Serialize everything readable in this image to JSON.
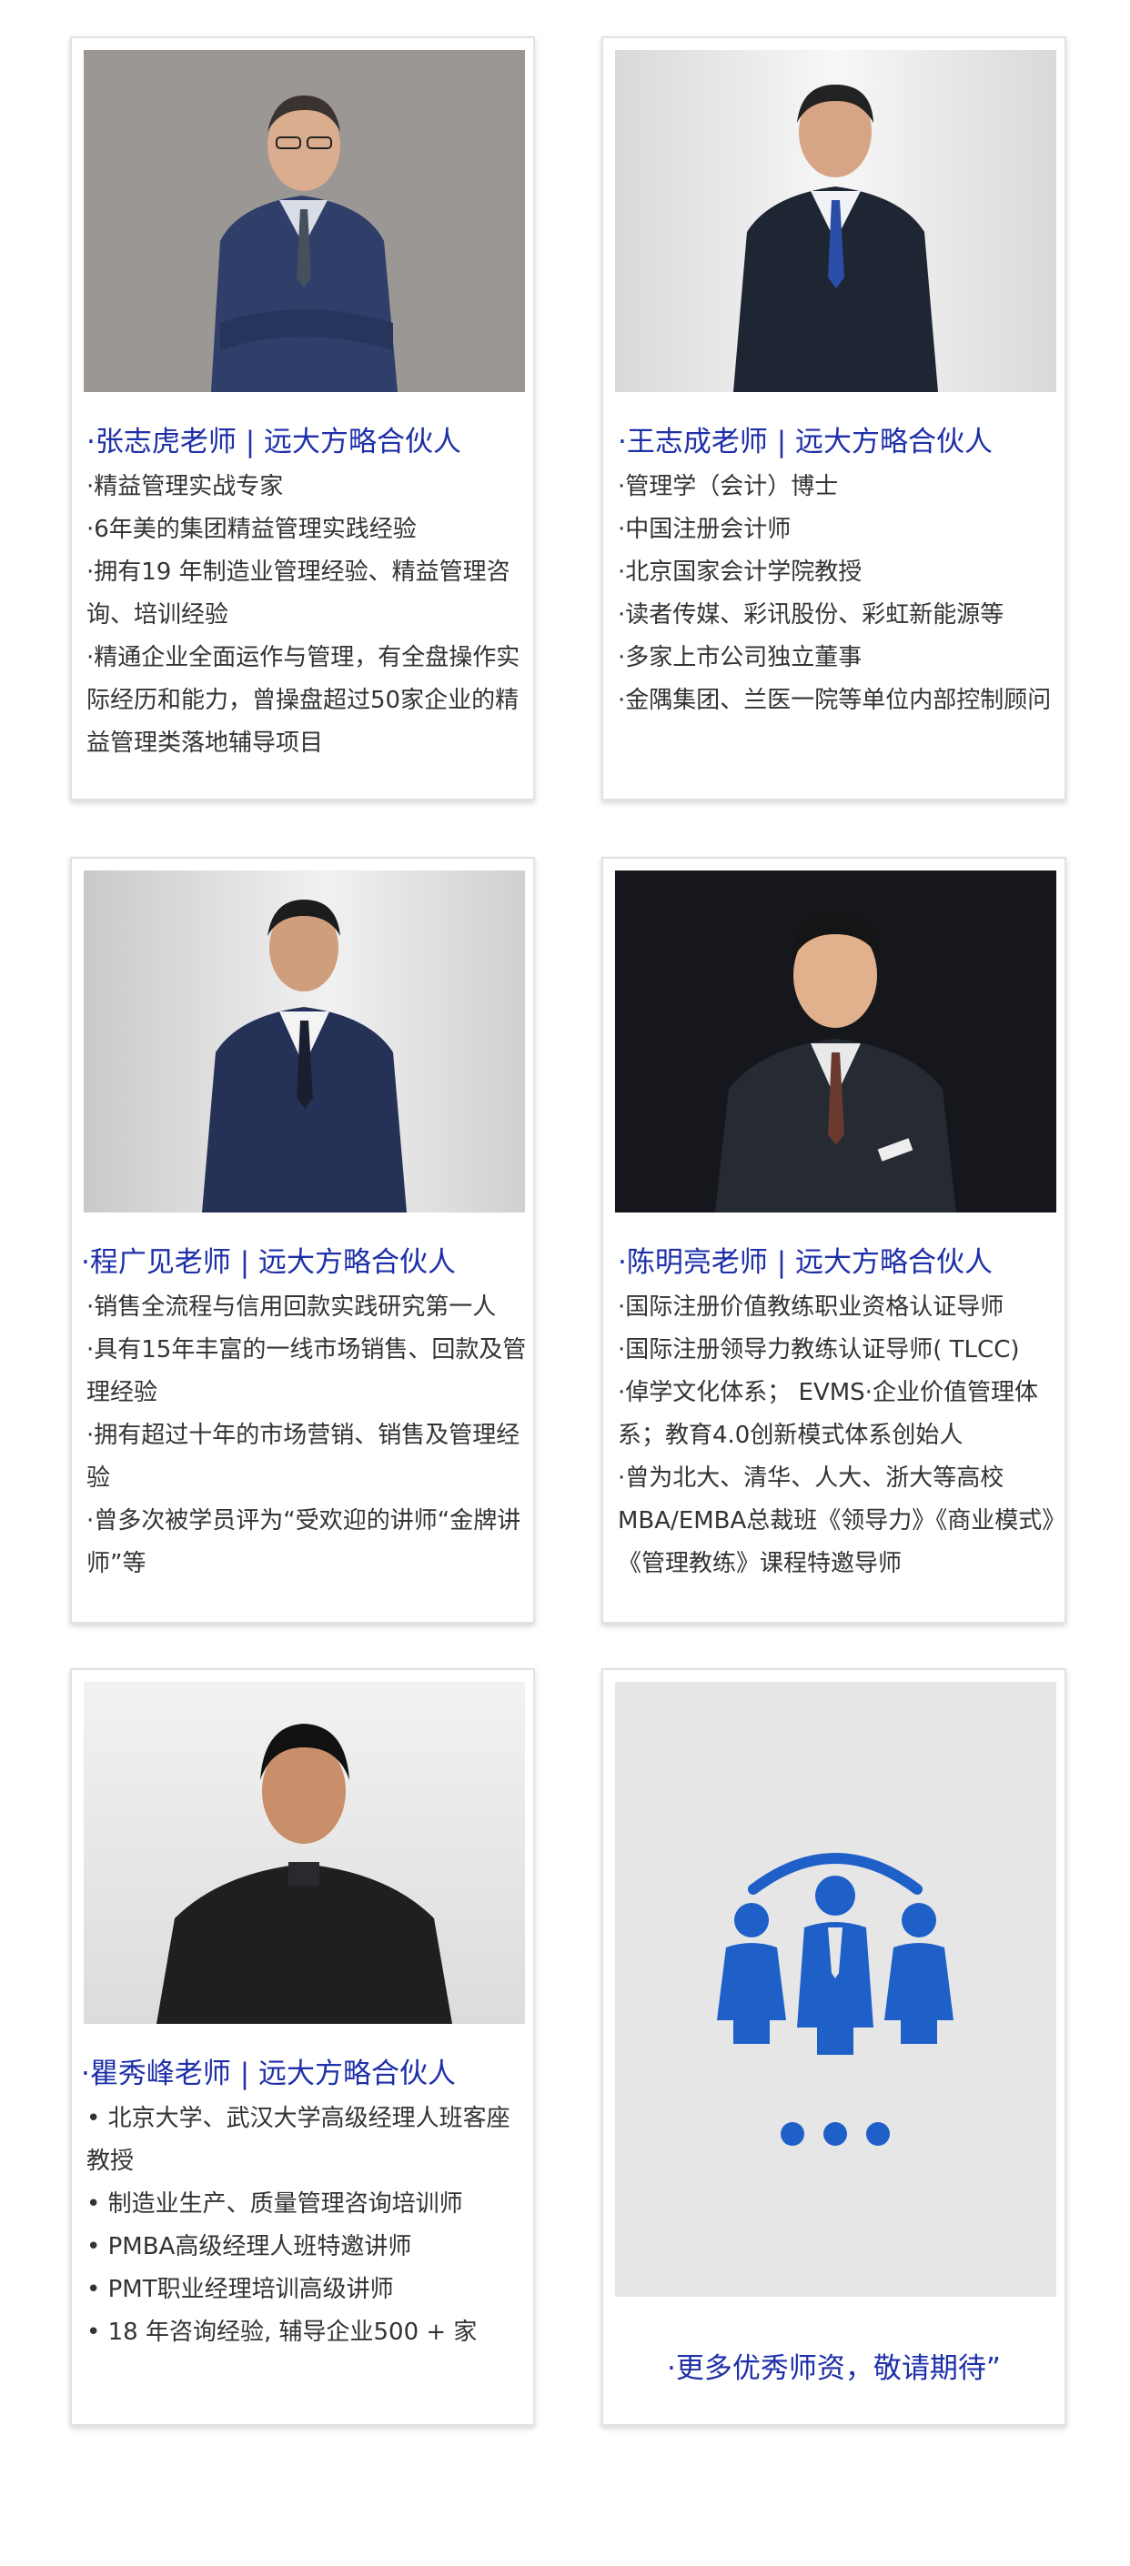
{
  "cards": [
    {
      "name": "·张志虎老师 | 远大方略合伙人",
      "bullets": [
        "·精益管理实战专家",
        "·6年美的集团精益管理实践经验",
        "·拥有19 年制造业管理经验、精益管理咨询、培训经验",
        "·精通企业全面运作与管理，有全盘操作实际经历和能力，曾操盘超过50家企业的精益管理类落地辅导项目"
      ]
    },
    {
      "name": "·王志成老师 | 远大方略合伙人",
      "bullets": [
        "·管理学（会计）博士",
        "·中国注册会计师",
        "·北京国家会计学院教授",
        "·读者传媒、彩讯股份、彩虹新能源等",
        "·多家上市公司独立董事",
        "·金隅集团、兰医一院等单位内部控制顾问"
      ]
    },
    {
      "name": "·程广见老师 | 远大方略合伙人",
      "bullets": [
        "·销售全流程与信用回款实践研究第一人",
        "·具有15年丰富的一线市场销售、回款及管理经验",
        "·拥有超过十年的市场营销、销售及管理经验",
        "·曾多次被学员评为“受欢迎的讲师“金牌讲师”等"
      ]
    },
    {
      "name": "·陈明亮老师 | 远大方略合伙人",
      "bullets": [
        "·国际注册价值教练职业资格认证导师",
        "·国际注册领导力教练认证导师( TLCC)",
        "·倬学文化体系； EVMS·企业价值管理体系；教育4.0创新模式体系创始人",
        "·曾为北大、清华、人大、浙大等高校MBA/EMBA总裁班《领导力》《商业模式》《管理教练》课程特邀导师"
      ]
    },
    {
      "name": "·瞿秀峰老师 | 远大方略合伙人",
      "bullets": [
        "• 北京大学、武汉大学高级经理人班客座教授",
        "• 制造业生产、质量管理咨询培训师",
        "• PMBA高级经理人班特邀讲师",
        "• PMT职业经理培训高级讲师",
        "• 18 年咨询经验, 辅导企业500 + 家"
      ]
    }
  ],
  "more": {
    "text": "·更多优秀师资，敬请期待”",
    "icon": "team-group-icon",
    "accent_color": "#1e5fc8"
  }
}
